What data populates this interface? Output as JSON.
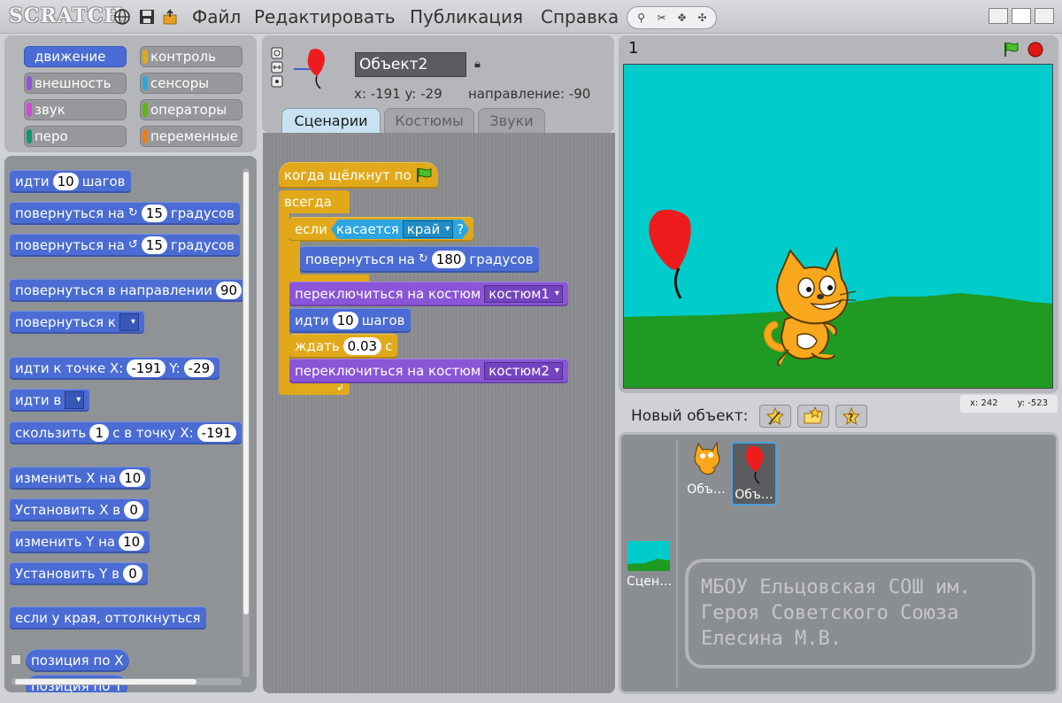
{
  "menubar": {
    "logo": "SCRATCH",
    "menus": [
      "Файл",
      "Редактировать",
      "Публикация",
      "Справка"
    ]
  },
  "categories": [
    {
      "label": "движение",
      "color": "#4a6cd4",
      "selected": true
    },
    {
      "label": "контроль",
      "color": "#e1a91a",
      "selected": false
    },
    {
      "label": "внешность",
      "color": "#8a55d7",
      "selected": false
    },
    {
      "label": "сенсоры",
      "color": "#2ca5e2",
      "selected": false
    },
    {
      "label": "звук",
      "color": "#cf4ad9",
      "selected": false
    },
    {
      "label": "операторы",
      "color": "#5cb712",
      "selected": false
    },
    {
      "label": "перо",
      "color": "#0e9a6c",
      "selected": false
    },
    {
      "label": "переменные",
      "color": "#ee7d16",
      "selected": false
    }
  ],
  "palette": {
    "move": {
      "a": "идти",
      "n": "10",
      "b": "шагов"
    },
    "turn_cw": {
      "a": "повернуться на",
      "n": "15",
      "b": "градусов"
    },
    "turn_ccw": {
      "a": "повернуться на",
      "n": "15",
      "b": "градусов"
    },
    "point_dir": {
      "a": "повернуться в направлении",
      "n": "90"
    },
    "point_towards": {
      "a": "повернуться к"
    },
    "goto_xy": {
      "a": "идти к точке X:",
      "x": "-191",
      "y_label": "Y:",
      "y": "-29"
    },
    "goto": {
      "a": "идти в"
    },
    "glide": {
      "a": "скользить",
      "n": "1",
      "b": "с в точку X:",
      "x": "-191"
    },
    "change_x": {
      "a": "изменить X на",
      "n": "10"
    },
    "set_x": {
      "a": "Установить X в",
      "n": "0"
    },
    "change_y": {
      "a": "изменить Y на",
      "n": "10"
    },
    "set_y": {
      "a": "Установить Y в",
      "n": "0"
    },
    "bounce": "если у края, оттолкнуться",
    "pos_x": "позиция по X",
    "pos_y": "позиция по Y"
  },
  "sprite": {
    "name": "Объект2",
    "coords": "x: -191  y: -29",
    "direction": "направление: -90"
  },
  "tabs": [
    "Сценарии",
    "Костюмы",
    "Звуки"
  ],
  "script": {
    "hat": "когда щёлкнут по",
    "forever": "всегда",
    "if": "если",
    "touching": "касается",
    "touching_target": "край",
    "q": "?",
    "turn": {
      "a": "повернуться на",
      "n": "180",
      "b": "градусов"
    },
    "costume1": {
      "a": "переключиться на костюм",
      "v": "костюм1"
    },
    "move": {
      "a": "идти",
      "n": "10",
      "b": "шагов"
    },
    "wait": {
      "a": "ждать",
      "n": "0.03",
      "b": "с"
    },
    "costume2": {
      "a": "переключиться на костюм",
      "v": "костюм2"
    }
  },
  "stage": {
    "title": "1",
    "mouse_x": "x: 242",
    "mouse_y": "y: -523"
  },
  "new_sprite_label": "Новый объект:",
  "sprites": [
    {
      "label": "Объ…"
    },
    {
      "label": "Объ…"
    }
  ],
  "stage_thumb_label": "Сцен…",
  "credit": {
    "line1": "МБОУ Ельцовская СОШ им.",
    "line2": "Героя Советского Союза",
    "line3": "Елесина М.В."
  }
}
